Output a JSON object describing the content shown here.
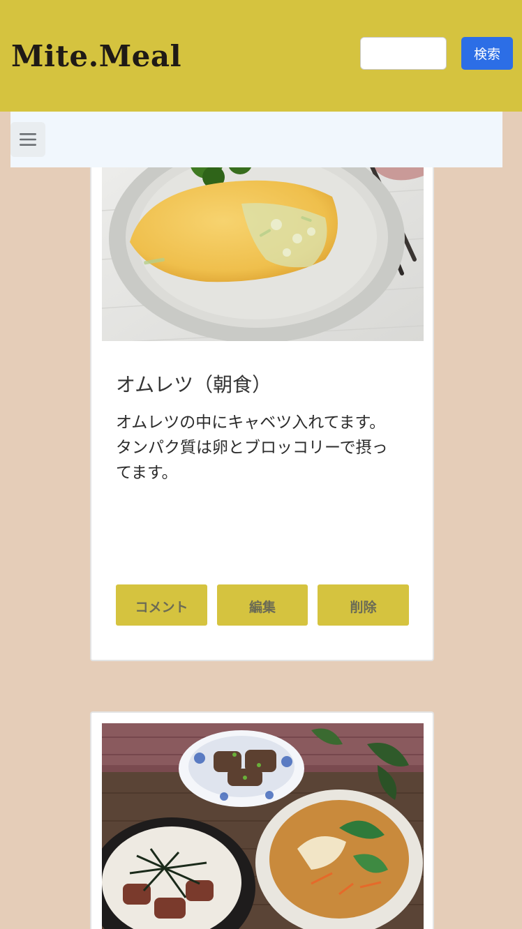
{
  "header": {
    "logo": "Mite.Meal",
    "search": {
      "value": "",
      "placeholder": ""
    },
    "search_button": "検索",
    "bg_color": "#d5c33f"
  },
  "navbar": {
    "menu_icon": "hamburger-menu-icon",
    "bg_color": "#f1f7fd"
  },
  "posts": [
    {
      "photo_subject": "omelette-photo",
      "title": "オムレツ（朝食）",
      "body_lines": [
        "オムレツの中にキャベツ入れてます。",
        "タンパク質は卵とブロッコリーで摂っ",
        "てます。"
      ],
      "actions": {
        "comment": "コメント",
        "edit": "編集",
        "delete": "削除"
      }
    },
    {
      "photo_subject": "donburi-and-soup-photo"
    }
  ],
  "colors": {
    "page_bg": "#e5cdb8",
    "accent": "#d5c33f",
    "search_button": "#2c6ee6"
  }
}
